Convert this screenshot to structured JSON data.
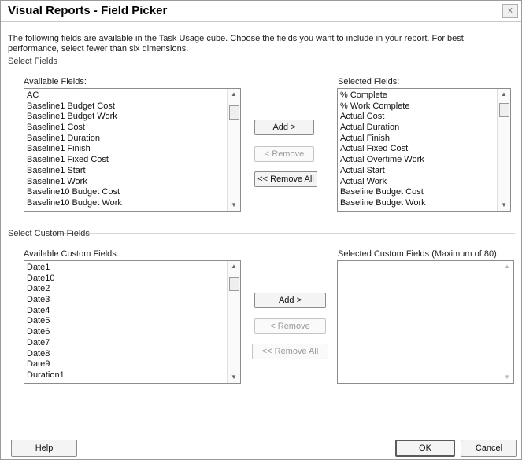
{
  "window": {
    "title": "Visual Reports - Field Picker",
    "close_glyph": "x",
    "description": "The following fields are available in the Task Usage cube. Choose the fields you want to include in your report. For best performance, select fewer than six dimensions."
  },
  "select_fields": {
    "section_label": "Select Fields",
    "available_label": "Available Fields:",
    "selected_label": "Selected Fields:",
    "available_items": [
      "AC",
      "Baseline1 Budget Cost",
      "Baseline1 Budget Work",
      "Baseline1 Cost",
      "Baseline1 Duration",
      "Baseline1 Finish",
      "Baseline1 Fixed Cost",
      "Baseline1 Start",
      "Baseline1 Work",
      "Baseline10 Budget Cost",
      "Baseline10 Budget Work"
    ],
    "selected_items": [
      "% Complete",
      "% Work Complete",
      "Actual Cost",
      "Actual Duration",
      "Actual Finish",
      "Actual Fixed Cost",
      "Actual Overtime Work",
      "Actual Start",
      "Actual Work",
      "Baseline Budget Cost",
      "Baseline Budget Work"
    ],
    "add_label": "Add >",
    "remove_label": "< Remove",
    "remove_all_label": "<< Remove All"
  },
  "custom_fields": {
    "section_label": "Select Custom Fields",
    "available_label": "Available Custom Fields:",
    "selected_label": "Selected Custom Fields (Maximum of 80):",
    "available_items": [
      "Date1",
      "Date10",
      "Date2",
      "Date3",
      "Date4",
      "Date5",
      "Date6",
      "Date7",
      "Date8",
      "Date9",
      "Duration1"
    ],
    "selected_items": [],
    "add_label": "Add >",
    "remove_label": "< Remove",
    "remove_all_label": "<< Remove All"
  },
  "footer": {
    "help_label": "Help",
    "ok_label": "OK",
    "cancel_label": "Cancel"
  },
  "icons": {
    "scroll_up": "scroll-up-arrow-icon",
    "scroll_down": "scroll-down-arrow-icon"
  }
}
